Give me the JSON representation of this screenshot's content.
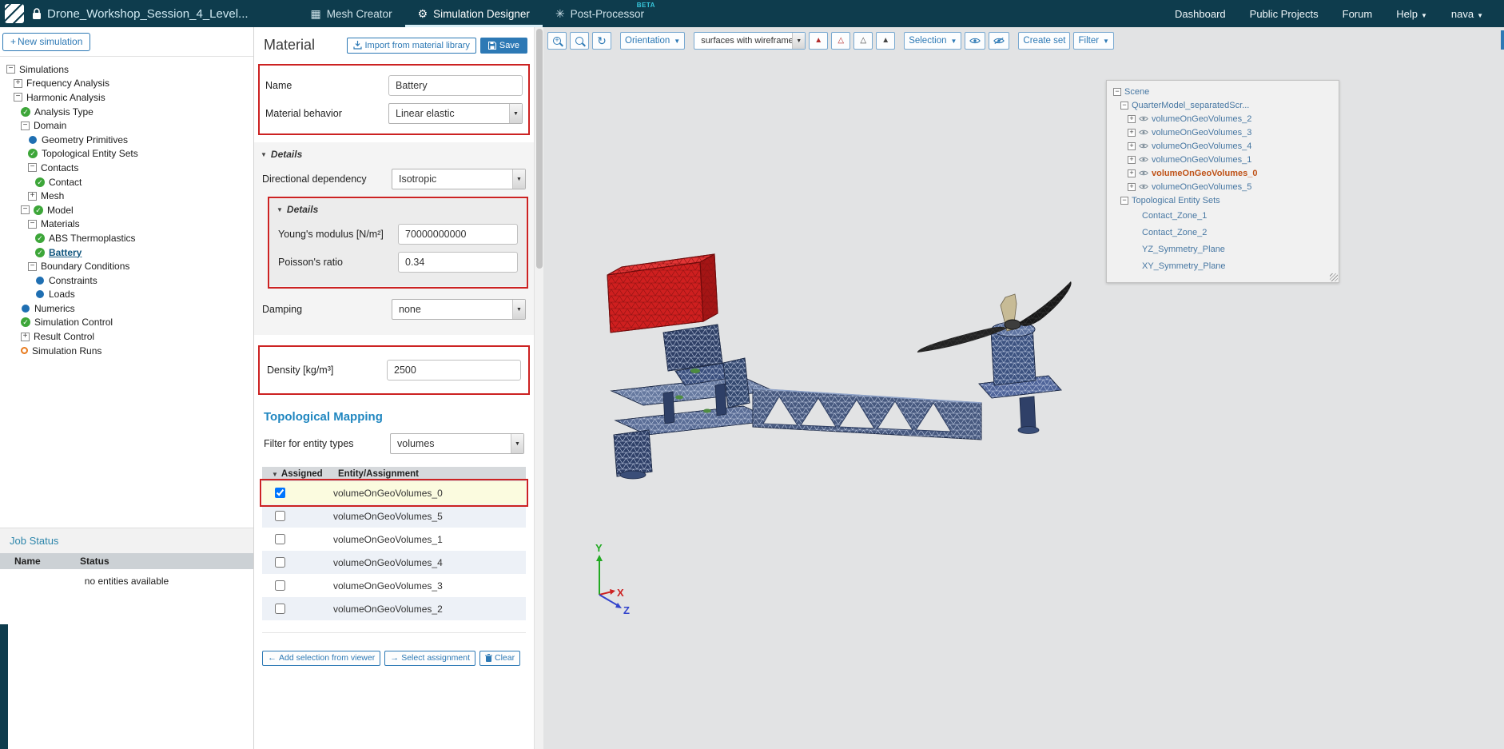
{
  "header": {
    "title": "Drone_Workshop_Session_4_Level...",
    "tabs": [
      {
        "label": "Mesh Creator",
        "icon": "grid",
        "active": false,
        "beta": false
      },
      {
        "label": "Simulation Designer",
        "icon": "gear",
        "active": true,
        "beta": false
      },
      {
        "label": "Post-Processor",
        "icon": "gauge",
        "active": false,
        "beta": true
      }
    ],
    "beta_label": "BETA",
    "links": [
      "Dashboard",
      "Public Projects",
      "Forum"
    ],
    "help_label": "Help",
    "user_label": "nava"
  },
  "sidebar": {
    "new_simulation_label": "New simulation",
    "tree": [
      {
        "label": "Simulations",
        "icon": "minus",
        "depth": 0
      },
      {
        "label": "Frequency Analysis",
        "icon": "plus",
        "depth": 1
      },
      {
        "label": "Harmonic Analysis",
        "icon": "minus",
        "depth": 1
      },
      {
        "label": "Analysis Type",
        "icon": "check",
        "depth": 2
      },
      {
        "label": "Domain",
        "icon": "minus",
        "depth": 2
      },
      {
        "label": "Geometry Primitives",
        "icon": "dot",
        "depth": 3
      },
      {
        "label": "Topological Entity Sets",
        "icon": "check",
        "depth": 3
      },
      {
        "label": "Contacts",
        "icon": "minus",
        "depth": 3
      },
      {
        "label": "Contact",
        "icon": "check",
        "depth": 4
      },
      {
        "label": "Mesh",
        "icon": "plus",
        "depth": 3
      },
      {
        "label": "Model",
        "icon": "minus-check",
        "depth": 2
      },
      {
        "label": "Materials",
        "icon": "minus",
        "depth": 3
      },
      {
        "label": "ABS Thermoplastics",
        "icon": "check",
        "depth": 4
      },
      {
        "label": "Battery",
        "icon": "check",
        "depth": 4,
        "selected": true
      },
      {
        "label": "Boundary Conditions",
        "icon": "minus",
        "depth": 3
      },
      {
        "label": "Constraints",
        "icon": "dot",
        "depth": 4
      },
      {
        "label": "Loads",
        "icon": "dot",
        "depth": 4
      },
      {
        "label": "Numerics",
        "icon": "dot",
        "depth": 2
      },
      {
        "label": "Simulation Control",
        "icon": "check",
        "depth": 2
      },
      {
        "label": "Result Control",
        "icon": "plus",
        "depth": 2
      },
      {
        "label": "Simulation Runs",
        "icon": "orange",
        "depth": 2
      }
    ],
    "job_status": {
      "title": "Job Status",
      "name_col": "Name",
      "status_col": "Status",
      "empty_text": "no entities available"
    }
  },
  "material": {
    "title": "Material",
    "import_label": "Import from material library",
    "save_label": "Save",
    "name_label": "Name",
    "name_value": "Battery",
    "behavior_label": "Material behavior",
    "behavior_value": "Linear elastic",
    "details_label": "Details",
    "directional_label": "Directional dependency",
    "directional_value": "Isotropic",
    "inner_details_label": "Details",
    "youngs_label": "Young's modulus [N/m²]",
    "youngs_value": "70000000000",
    "poisson_label": "Poisson's ratio",
    "poisson_value": "0.34",
    "damping_label": "Damping",
    "damping_value": "none",
    "density_label": "Density [kg/m³]",
    "density_value": "2500",
    "topo_title": "Topological Mapping",
    "filter_label": "Filter for entity types",
    "filter_value": "volumes",
    "table": {
      "assigned_col": "Assigned",
      "entity_col": "Entity/Assignment",
      "rows": [
        {
          "name": "volumeOnGeoVolumes_0",
          "checked": true,
          "selected": true
        },
        {
          "name": "volumeOnGeoVolumes_5",
          "checked": false
        },
        {
          "name": "volumeOnGeoVolumes_1",
          "checked": false
        },
        {
          "name": "volumeOnGeoVolumes_4",
          "checked": false
        },
        {
          "name": "volumeOnGeoVolumes_3",
          "checked": false
        },
        {
          "name": "volumeOnGeoVolumes_2",
          "checked": false
        }
      ]
    },
    "actions": {
      "add_label": "Add selection from viewer",
      "select_label": "Select assignment",
      "clear_label": "Clear"
    }
  },
  "viewer": {
    "toolbar": {
      "orientation_label": "Orientation",
      "display_mode": "surfaces with wireframe",
      "selection_label": "Selection",
      "create_set_label": "Create set",
      "filter_label": "Filter"
    },
    "scene_tree": [
      {
        "label": "Scene",
        "type": "branch",
        "depth": 0
      },
      {
        "label": "QuarterModel_separatedScr...",
        "type": "branch",
        "depth": 1
      },
      {
        "label": "volumeOnGeoVolumes_2",
        "type": "volume",
        "depth": 2
      },
      {
        "label": "volumeOnGeoVolumes_3",
        "type": "volume",
        "depth": 2
      },
      {
        "label": "volumeOnGeoVolumes_4",
        "type": "volume",
        "depth": 2
      },
      {
        "label": "volumeOnGeoVolumes_1",
        "type": "volume",
        "depth": 2
      },
      {
        "label": "volumeOnGeoVolumes_0",
        "type": "volume",
        "depth": 2,
        "highlight": true
      },
      {
        "label": "volumeOnGeoVolumes_5",
        "type": "volume",
        "depth": 2
      },
      {
        "label": "Topological Entity Sets",
        "type": "branch",
        "depth": 1
      },
      {
        "label": "Contact_Zone_1",
        "type": "plain",
        "depth": 2
      },
      {
        "label": "Contact_Zone_2",
        "type": "plain",
        "depth": 2
      },
      {
        "label": "YZ_Symmetry_Plane",
        "type": "plain",
        "depth": 2
      },
      {
        "label": "XY_Symmetry_Plane",
        "type": "plain",
        "depth": 2
      }
    ],
    "axes": {
      "x": "X",
      "y": "Y",
      "z": "Z"
    }
  },
  "colors": {
    "accent": "#2d79b5",
    "header_bg": "#0e3c4d",
    "annotation": "#cc2222",
    "scene_highlight": "#bf5217",
    "battery_red": "#cf1f1f"
  }
}
